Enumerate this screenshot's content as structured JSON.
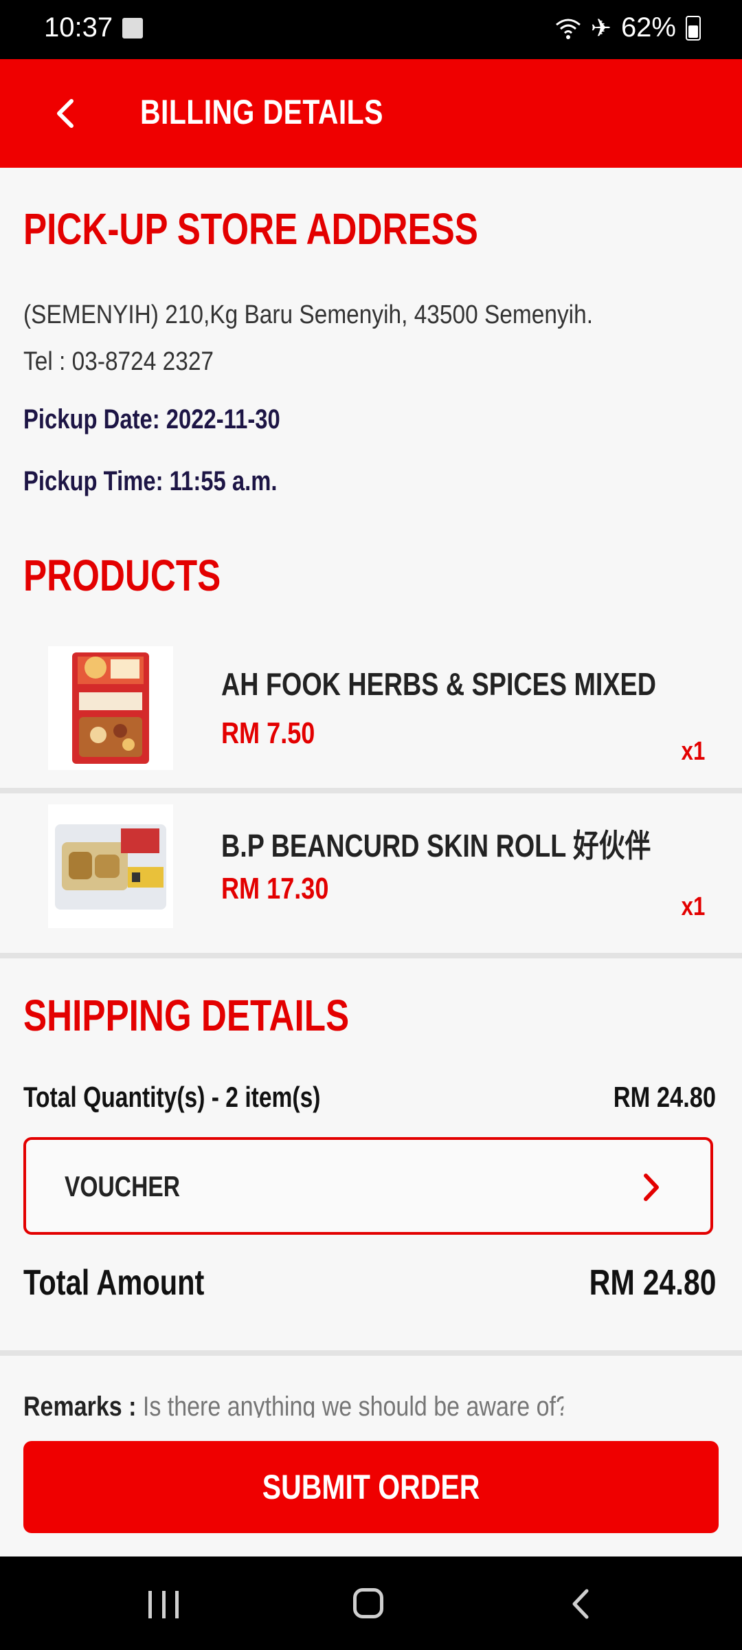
{
  "status_bar": {
    "time": "10:37",
    "battery": "62%"
  },
  "header": {
    "title": "BILLING DETAILS"
  },
  "pickup": {
    "section_title": "PICK-UP STORE ADDRESS",
    "address": "(SEMENYIH) 210,Kg Baru Semenyih, 43500 Semenyih. Tel : 03-8724 2327",
    "date": "Pickup Date: 2022-11-30",
    "time": "Pickup Time: 11:55 a.m."
  },
  "products": {
    "section_title": "PRODUCTS",
    "items": [
      {
        "name": "AH FOOK HERBS & SPICES MIXED",
        "price": "RM 7.50",
        "qty": "x1"
      },
      {
        "name": "B.P BEANCURD SKIN ROLL 好伙伴",
        "price": "RM 17.30",
        "qty": "x1"
      }
    ]
  },
  "shipping": {
    "section_title": "SHIPPING DETAILS",
    "total_quantity_label": "Total Quantity(s) - 2 item(s)",
    "subtotal": "RM 24.80",
    "voucher_label": "VOUCHER",
    "total_label": "Total Amount",
    "total_value": "RM 24.80"
  },
  "remarks": {
    "label": "Remarks :",
    "placeholder": "Is there anything we should be aware of?"
  },
  "submit": {
    "label": "SUBMIT ORDER"
  },
  "colors": {
    "accent": "#ef0000",
    "dark_text": "#1d1545"
  }
}
